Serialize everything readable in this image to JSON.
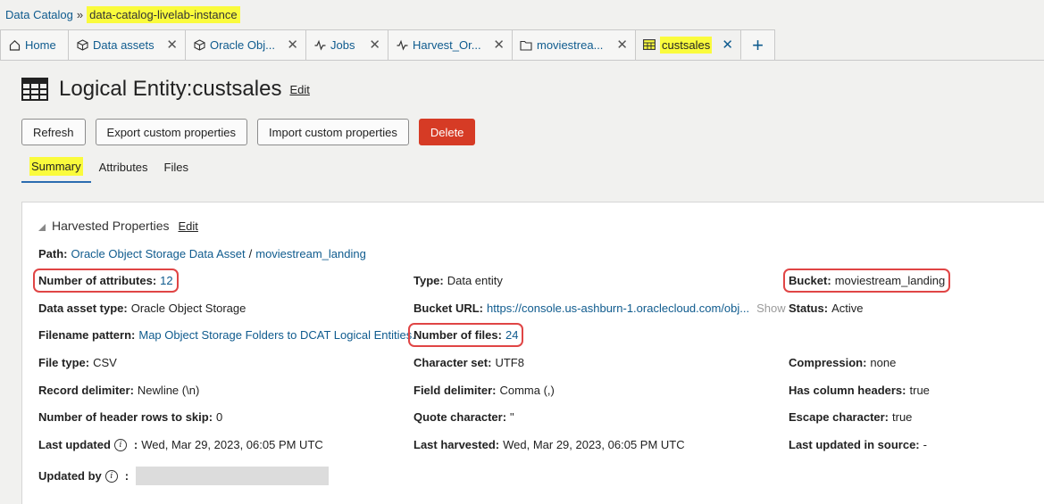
{
  "breadcrumb": {
    "root": "Data Catalog",
    "separator": "»",
    "current": "data-catalog-livelab-instance"
  },
  "tabs": [
    {
      "label": "Home",
      "icon": "home-icon",
      "closable": false
    },
    {
      "label": "Data assets",
      "icon": "cube-icon",
      "closable": true
    },
    {
      "label": "Oracle Obj...",
      "icon": "cube-icon",
      "closable": true
    },
    {
      "label": "Jobs",
      "icon": "activity-icon",
      "closable": true
    },
    {
      "label": "Harvest_Or...",
      "icon": "activity-icon",
      "closable": true
    },
    {
      "label": "moviestrea...",
      "icon": "folder-icon",
      "closable": true
    },
    {
      "label": "custsales",
      "icon": "table-icon",
      "closable": true,
      "active": true
    }
  ],
  "add_tab_label": "+",
  "title": {
    "text": "Logical Entity:custsales",
    "edit": "Edit"
  },
  "actions": {
    "refresh": "Refresh",
    "export": "Export custom properties",
    "import": "Import custom properties",
    "delete": "Delete"
  },
  "subtabs": [
    "Summary",
    "Attributes",
    "Files"
  ],
  "section": {
    "title": "Harvested Properties",
    "edit": "Edit"
  },
  "path": {
    "label": "Path:",
    "asset": "Oracle Object Storage Data Asset",
    "sep": "/",
    "folder": "moviestream_landing"
  },
  "props": {
    "num_attributes": {
      "k": "Number of attributes:",
      "v": "12"
    },
    "data_asset_type": {
      "k": "Data asset type:",
      "v": "Oracle Object Storage"
    },
    "filename_pattern": {
      "k": "Filename pattern:",
      "v": "Map Object Storage Folders to DCAT Logical Entities."
    },
    "file_type": {
      "k": "File type:",
      "v": "CSV"
    },
    "record_delimiter": {
      "k": "Record delimiter:",
      "v": "Newline (\\n)"
    },
    "header_rows": {
      "k": "Number of header rows to skip:",
      "v": "0"
    },
    "last_updated": {
      "k": "Last updated",
      "colon": ":",
      "v": "Wed, Mar 29, 2023, 06:05 PM UTC"
    },
    "updated_by": {
      "k": "Updated by",
      "colon": ":"
    },
    "type": {
      "k": "Type:",
      "v": "Data entity"
    },
    "bucket_url": {
      "k": "Bucket URL:",
      "v": "https://console.us-ashburn-1.oraclecloud.com/obj...",
      "show": "Show"
    },
    "num_files": {
      "k": "Number of files:",
      "v": "24"
    },
    "character_set": {
      "k": "Character set:",
      "v": "UTF8"
    },
    "field_delimiter": {
      "k": "Field delimiter:",
      "v": "Comma (,)"
    },
    "quote_character": {
      "k": "Quote character:",
      "v": "\""
    },
    "last_harvested": {
      "k": "Last harvested:",
      "v": "Wed, Mar 29, 2023, 06:05 PM UTC"
    },
    "bucket": {
      "k": "Bucket:",
      "v": "moviestream_landing"
    },
    "status": {
      "k": "Status:",
      "v": "Active"
    },
    "compression": {
      "k": "Compression:",
      "v": "none"
    },
    "has_column_headers": {
      "k": "Has column headers:",
      "v": "true"
    },
    "escape_character": {
      "k": "Escape character:",
      "v": "true"
    },
    "last_updated_source": {
      "k": "Last updated in source:",
      "v": "-"
    }
  },
  "colors": {
    "link": "#0f5b8e",
    "highlight": "#fafb3c",
    "delete_button": "#d63b25",
    "annotation_box": "#e04545"
  }
}
